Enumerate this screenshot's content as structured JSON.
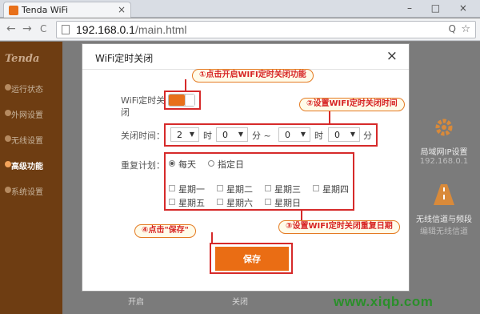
{
  "browser": {
    "tab_title": "Tenda WiFi",
    "tab_close": "×",
    "window_controls": "– □ ×",
    "back": "←",
    "forward": "→",
    "reload": "C",
    "url_host": "192.168.0.1",
    "url_path": "/main.html",
    "zoom_icon": "Q",
    "menu_icon": "☆"
  },
  "sidebar": {
    "brand": "Tenda",
    "items": [
      {
        "label": "运行状态"
      },
      {
        "label": "外网设置"
      },
      {
        "label": "无线设置"
      },
      {
        "label": "高级功能"
      },
      {
        "label": "系统设置"
      }
    ]
  },
  "background": {
    "lan_title": "局域网IP设置",
    "lan_ip": "192.168.0.1",
    "wifi_title": "无线信道与频段",
    "wifi_sub": "编辑无线信道",
    "bottom_left": "开启",
    "bottom_right": "关闭"
  },
  "modal": {
    "title": "WiFi定时关闭",
    "close": "×",
    "enable_label": "WiFi定时关闭",
    "off_time_label": "关闭时间：",
    "from_hour": "2",
    "from_min": "0",
    "to_hour": "0",
    "to_min": "0",
    "unit_hour": "时",
    "unit_min": "分",
    "unit_min_tilde": "分 ~",
    "repeat_label": "重复计划：",
    "opt_everyday": "每天",
    "opt_specific": "指定日",
    "days": [
      "星期一",
      "星期二",
      "星期三",
      "星期四",
      "星期五",
      "星期六",
      "星期日"
    ],
    "save": "保存"
  },
  "annotations": {
    "step1": "①点击开启WIFI定时关闭功能",
    "step2": "②设置WIFI定时关闭时间",
    "step3": "③设置WIFI定时关闭重复日期",
    "step4": "④点击\"保存\""
  },
  "watermark": "www.xiqb.com",
  "colors": {
    "accent": "#e8701a",
    "annotation_red": "#d62a2a",
    "sidebar_bg": "#6e3d12",
    "watermark": "#2a8f2a"
  }
}
